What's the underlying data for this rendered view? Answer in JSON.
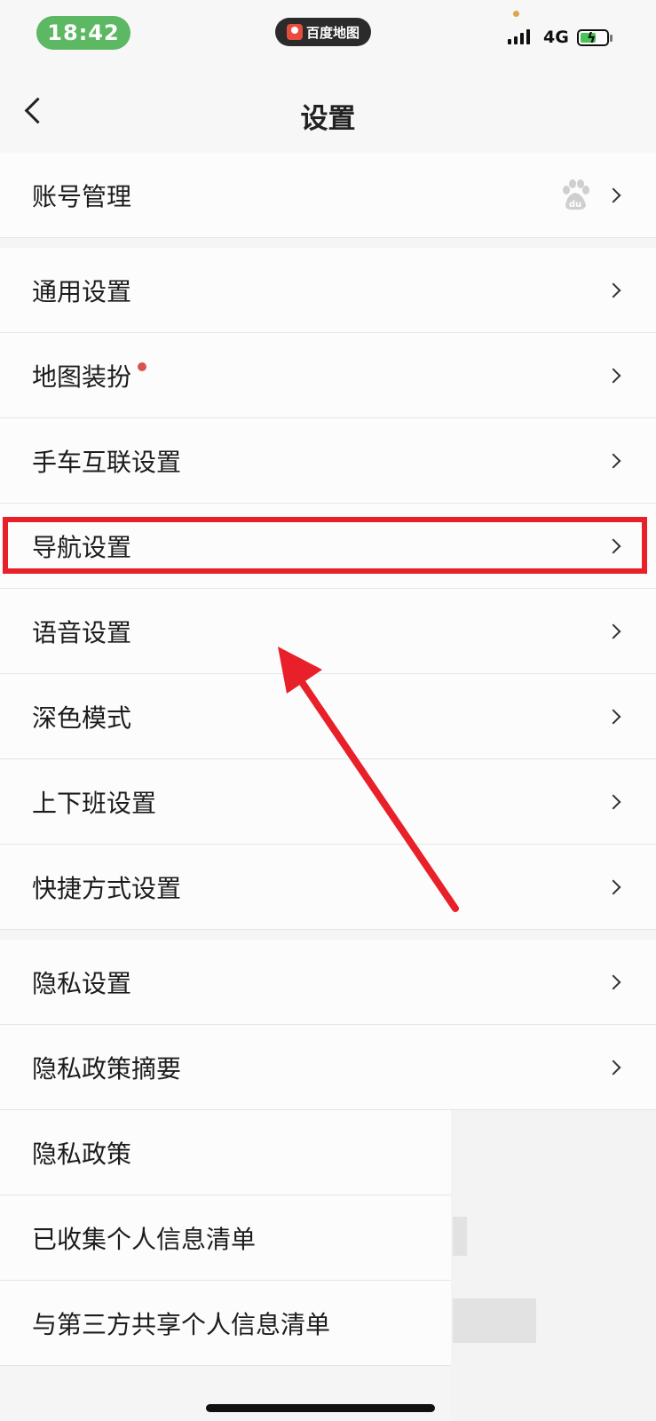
{
  "status_bar": {
    "time": "18:42",
    "app_name": "百度地图",
    "network": "4G",
    "battery_icon": "battery-charging-icon",
    "signal_icon": "signal-bars-icon"
  },
  "nav": {
    "title": "设置",
    "back_icon": "chevron-left-icon"
  },
  "sections": [
    {
      "items": [
        {
          "label": "账号管理",
          "trailing_icon": "baidu-paw-icon"
        }
      ]
    },
    {
      "items": [
        {
          "label": "通用设置"
        },
        {
          "label": "地图装扮",
          "badge": "red-dot"
        },
        {
          "label": "手车互联设置"
        },
        {
          "label": "导航设置",
          "highlighted": true
        },
        {
          "label": "语音设置"
        },
        {
          "label": "深色模式"
        },
        {
          "label": "上下班设置"
        },
        {
          "label": "快捷方式设置"
        }
      ]
    },
    {
      "items": [
        {
          "label": "隐私设置"
        },
        {
          "label": "隐私政策摘要"
        },
        {
          "label": "隐私政策"
        },
        {
          "label": "已收集个人信息清单"
        },
        {
          "label": "与第三方共享个人信息清单"
        }
      ]
    }
  ],
  "colors": {
    "highlight": "#e8202a",
    "time_pill": "#5cb862",
    "badge": "#d9534f"
  }
}
